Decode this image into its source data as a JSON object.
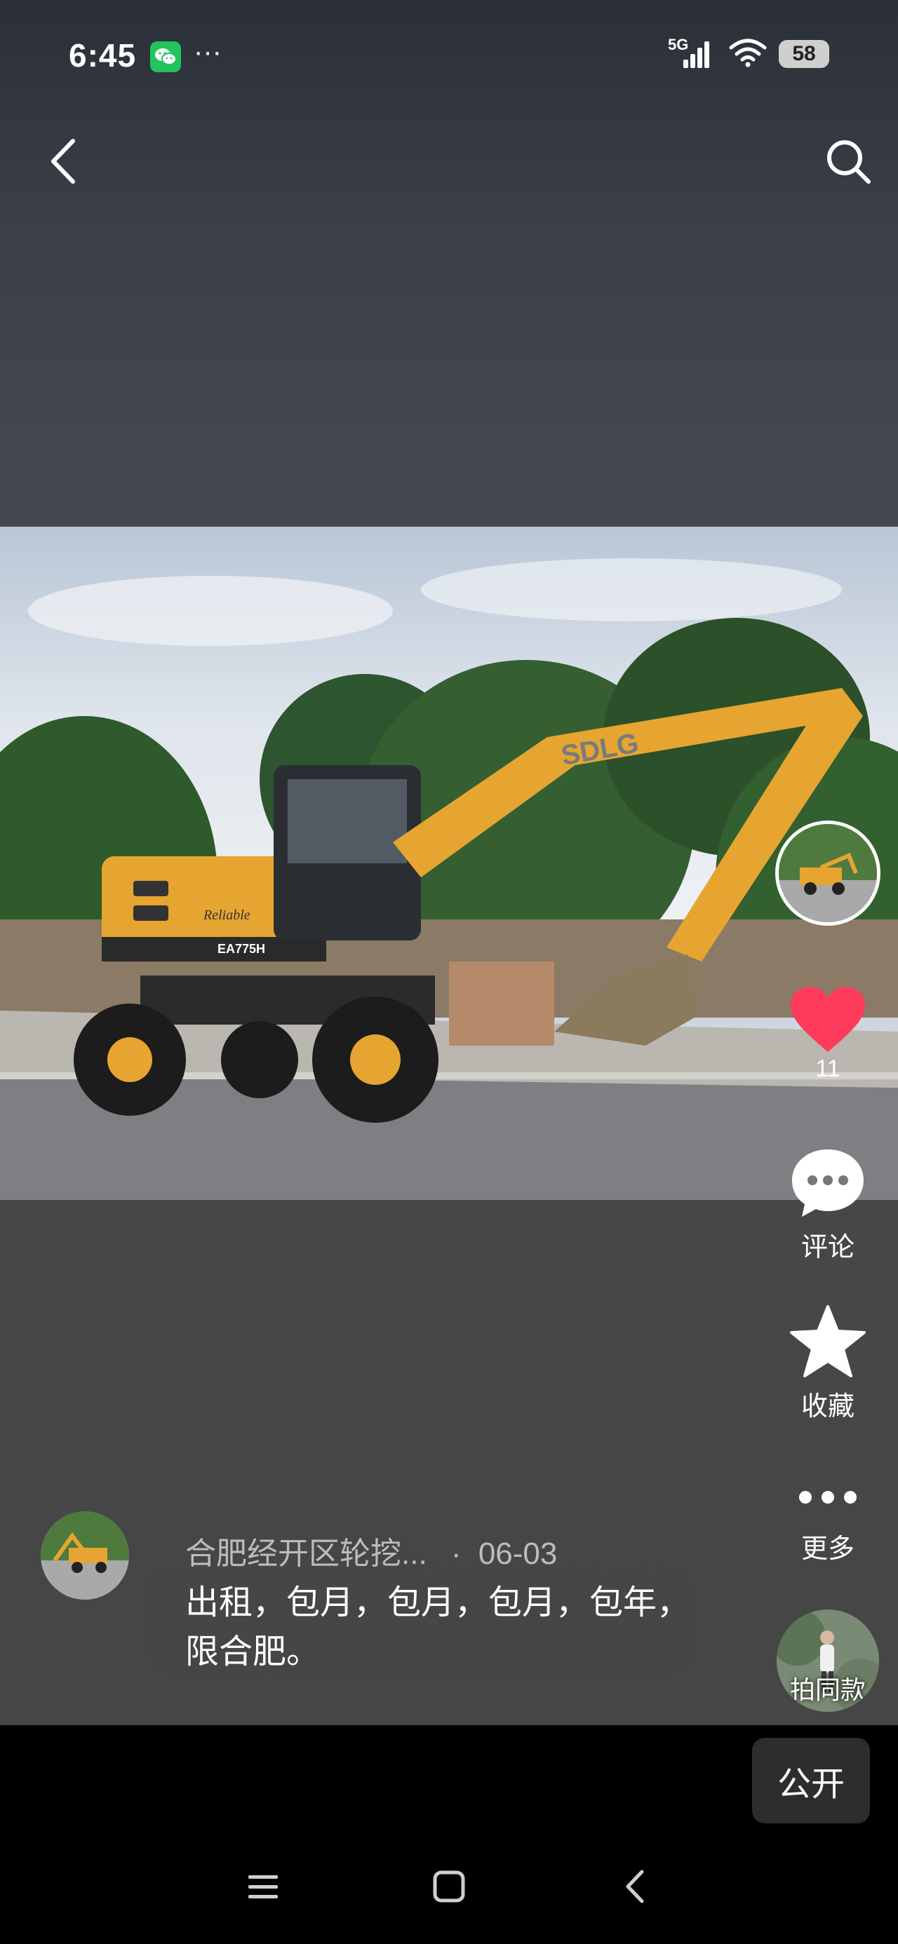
{
  "status_bar": {
    "time": "6:45",
    "more": "···",
    "network": "5G",
    "battery": "58"
  },
  "nav": {
    "back_icon": "back-icon",
    "search_icon": "search-icon"
  },
  "photo": {
    "brand": "SDLG",
    "model": "EA775H",
    "decal": "Reliable"
  },
  "side_rail": {
    "likes": "11",
    "comment_label": "评论",
    "favorite_label": "收藏",
    "more_label": "更多",
    "same_style_label": "拍同款",
    "like_color": "#ff3b5c"
  },
  "post": {
    "author": "合肥经开区轮挖...",
    "separator": "·",
    "date": "06-03",
    "caption": "出租，包月，包月，包月，包年，限合肥。"
  },
  "publish_button": "公开"
}
